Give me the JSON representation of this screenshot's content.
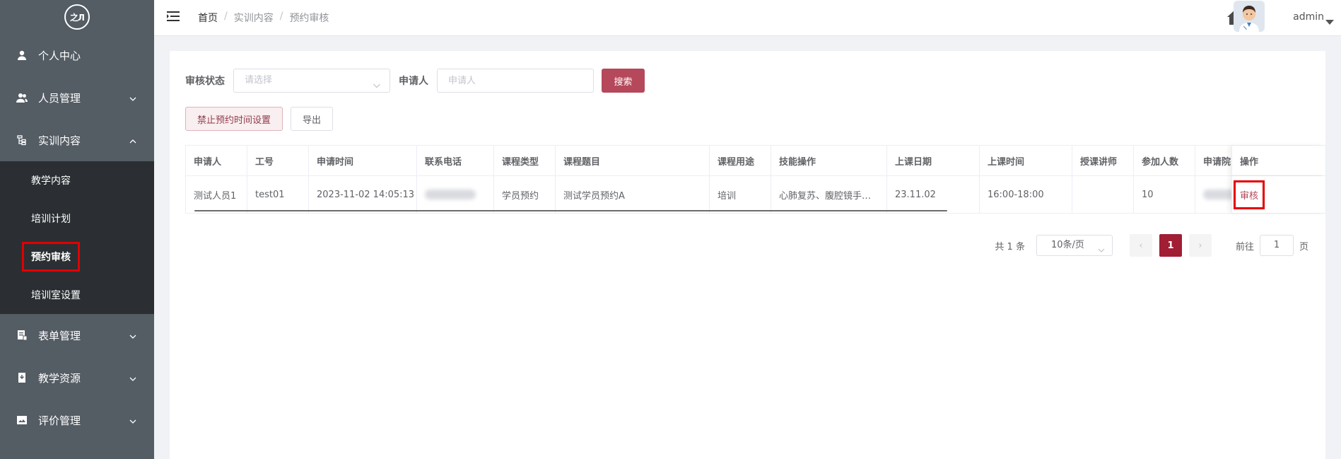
{
  "logo": {
    "text": "之Л"
  },
  "sidebar": {
    "items": [
      {
        "label": "个人中心"
      },
      {
        "label": "人员管理"
      },
      {
        "label": "实训内容"
      },
      {
        "label": "表单管理"
      },
      {
        "label": "教学资源"
      },
      {
        "label": "评价管理"
      }
    ],
    "submenu": [
      {
        "label": "教学内容"
      },
      {
        "label": "培训计划"
      },
      {
        "label": "预约审核"
      },
      {
        "label": "培训室设置"
      }
    ]
  },
  "header": {
    "breadcrumb": [
      "首页",
      "实训内容",
      "预约审核"
    ],
    "separator": "/",
    "user": "admin"
  },
  "filters": {
    "status_label": "审核状态",
    "status_placeholder": "请选择",
    "applicant_label": "申请人",
    "applicant_placeholder": "申请人",
    "search_label": "搜索"
  },
  "actions": {
    "forbid_label": "禁止预约时间设置",
    "export_label": "导出"
  },
  "table": {
    "columns": [
      "申请人",
      "工号",
      "申请时间",
      "联系电话",
      "课程类型",
      "课程题目",
      "课程用途",
      "技能操作",
      "上课日期",
      "上课时间",
      "授课讲师",
      "参加人数",
      "申请院"
    ],
    "op_header": "操作",
    "rows": [
      {
        "cells": [
          "测试人员1",
          "test01",
          "2023-11-02 14:05:13",
          "",
          "学员预约",
          "测试学员预约A",
          "培训",
          "心肺复苏、腹腔镜手…",
          "23.11.02",
          "16:00-18:00",
          "",
          "10",
          ""
        ],
        "op": "审核"
      }
    ]
  },
  "pagination": {
    "total": "共 1 条",
    "page_size": "10条/页",
    "prev": "‹",
    "page": "1",
    "next": "›",
    "goto_label": "前往",
    "goto_value": "1",
    "page_suffix": "页"
  }
}
